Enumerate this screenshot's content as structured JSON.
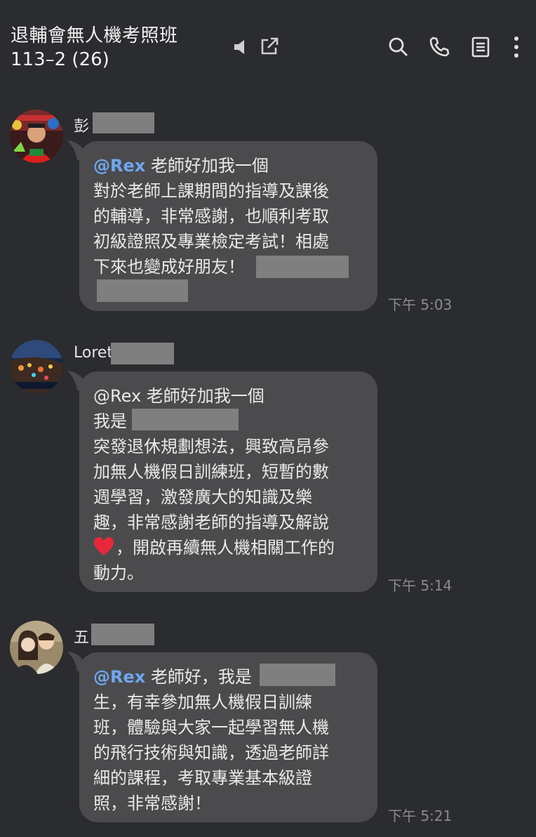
{
  "header": {
    "title_line1": "退輔會無人機考照班",
    "title_line2": "113–2 (26)",
    "icons": [
      "speaker-icon",
      "popout-icon",
      "search-icon",
      "phone-icon",
      "notes-icon",
      "more-icon"
    ]
  },
  "messages": [
    {
      "sender": "彭",
      "mention": "@Rex",
      "lines": [
        "老師好加我一個",
        "對於老師上課期間的指導及課後",
        "的輔導，非常感謝，也順利考取",
        "初級證照及專業檢定考試！相處",
        "下來也變成好朋友！",
        ""
      ],
      "time": "下午 5:03"
    },
    {
      "sender": "Loret",
      "mention": "@Rex",
      "lines": [
        "老師好加我一個",
        "我是",
        "突發退休規劃想法，興致高昂參",
        "加無人機假日訓練班，短暫的數",
        "週學習，激發廣大的知識及樂",
        "趣，非常感謝老師的指導及解說",
        "，開啟再續無人機相關工作的",
        "動力。"
      ],
      "time": "下午 5:14"
    },
    {
      "sender": "五",
      "mention": "@Rex",
      "lines": [
        "老師好，我是",
        "生，有幸參加無人機假日訓練",
        "班，體驗與大家一起學習無人機",
        "的飛行技術與知識，透過老師詳",
        "細的課程，考取專業基本級證",
        "照，非常感謝！"
      ],
      "time": "下午 5:21"
    }
  ],
  "colors": {
    "background": "#2b2c2f",
    "bubble": "#4b4b4d",
    "mention": "#6fa6ef",
    "time": "#8a8b8e"
  }
}
